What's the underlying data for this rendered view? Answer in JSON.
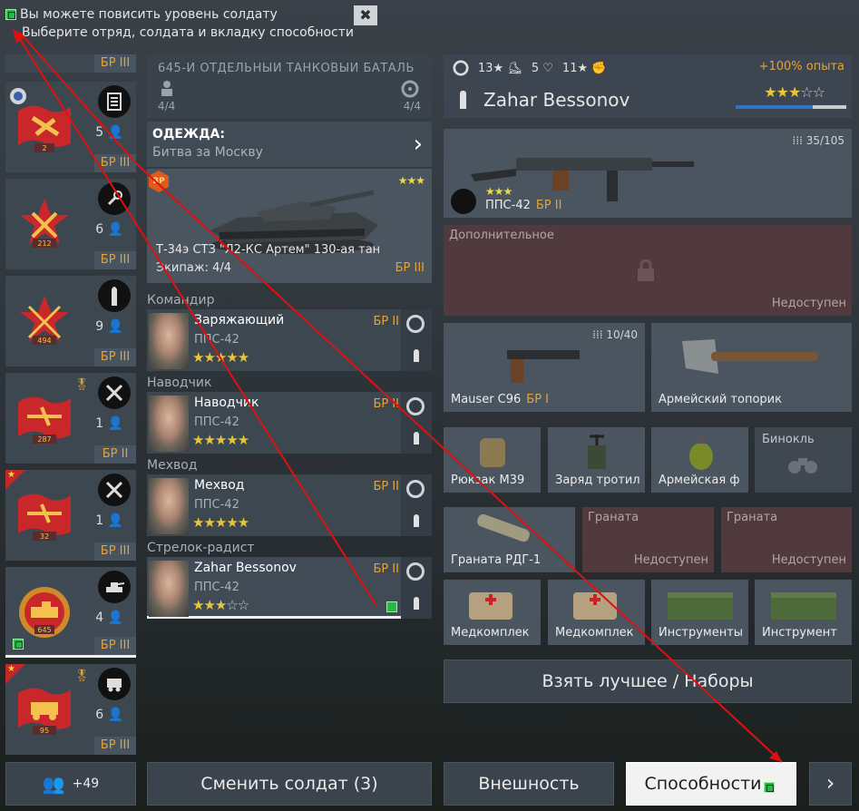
{
  "hint": {
    "line1": "Вы можете повисить уровень солдату",
    "line2": "Выберите отряд, солдата и вкладку способности",
    "close": "✖"
  },
  "squads": {
    "top_br": "БР III",
    "items": [
      {
        "count": "5",
        "br": "БР III",
        "flag_num": "2",
        "icon": "manual-icon"
      },
      {
        "count": "6",
        "br": "БР III",
        "flag_num": "212",
        "icon": "wrench-icon"
      },
      {
        "count": "9",
        "br": "БР III",
        "flag_num": "494",
        "icon": "bullet-icon"
      },
      {
        "count": "1",
        "br": "БР II",
        "flag_num": "287",
        "icon": "crossed-guns-icon"
      },
      {
        "count": "1",
        "br": "БР III",
        "flag_num": "32",
        "icon": "crossed-guns-icon"
      },
      {
        "count": "4",
        "br": "БР III",
        "flag_num": "645",
        "icon": "tank-icon"
      },
      {
        "count": "6",
        "br": "БР III",
        "flag_num": "95",
        "icon": "truck-icon"
      }
    ],
    "reserve": "+49"
  },
  "unit": {
    "title": "645-Й ОТДЕЛЬНЫЙ ТАНКОВЫЙ БАТАЛЬ",
    "soldiers": "4/4",
    "vehicles": "4/4"
  },
  "clothes": {
    "label": "ОДЕЖДА:",
    "value": "Битва за Москву"
  },
  "vehicle": {
    "badge": "BP",
    "stars": "★★★",
    "name": "Т-34э СТЗ \"Л2-КС Артем\" 130-ая тан",
    "crew": "Экипаж: 4/4",
    "br": "БР III"
  },
  "crew": [
    {
      "role": "Командир",
      "name": "Заряжающий",
      "weapon": "ППС-42",
      "stars": "★★★★★",
      "empty": "",
      "br": "БР II"
    },
    {
      "role": "Наводчик",
      "name": "Наводчик",
      "weapon": "ППС-42",
      "stars": "★★★★★",
      "empty": "",
      "br": "БР II"
    },
    {
      "role": "Мехвод",
      "name": "Мехвод",
      "weapon": "ППС-42",
      "stars": "★★★★★",
      "empty": "",
      "br": "БР II"
    },
    {
      "role": "Стрелок-радист",
      "name": "Zahar Bessonov",
      "weapon": "ППС-42",
      "stars": "★★★",
      "empty": "☆☆",
      "br": "БР II"
    }
  ],
  "soldier": {
    "stat1": "13★",
    "stat2": "5",
    "stat3": "11★",
    "exp": "+100% опыта",
    "name": "Zahar Bessonov",
    "stars": "★★★",
    "empty": "☆☆"
  },
  "primary": {
    "ammo": "35/105",
    "name": "ППС-42",
    "br": "БР II",
    "stars": "★★★"
  },
  "extra": {
    "label": "Дополнительное",
    "status": "Недоступен"
  },
  "secondary": [
    {
      "name": "Mauser C96",
      "br": "БР I",
      "ammo": "10/40"
    },
    {
      "name": "Армейский топорик"
    }
  ],
  "gear": [
    {
      "name": "Рюкзак М39"
    },
    {
      "name": "Заряд тротил"
    },
    {
      "name": "Армейская ф"
    },
    {
      "name": "Бинокль"
    }
  ],
  "grenades": [
    {
      "name": "Граната РДГ-1"
    },
    {
      "label": "Граната",
      "status": "Недоступен"
    },
    {
      "label": "Граната",
      "status": "Недоступен"
    }
  ],
  "kits": [
    {
      "name": "Медкомплек"
    },
    {
      "name": "Медкомплек"
    },
    {
      "name": "Инструменты"
    },
    {
      "name": "Инструмент"
    }
  ],
  "buttons": {
    "best": "Взять лучшее / Наборы",
    "change": "Сменить солдат (3)",
    "look": "Внешность",
    "abilities": "Способности",
    "next": "›"
  }
}
